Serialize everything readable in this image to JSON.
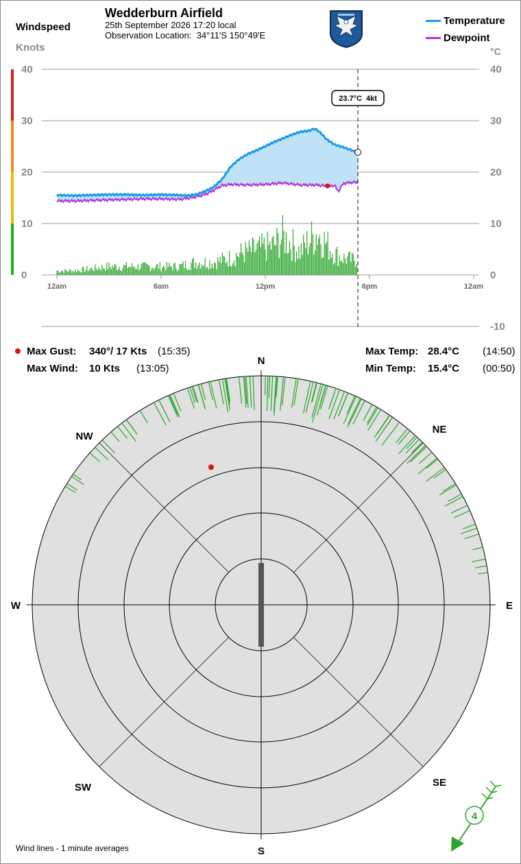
{
  "station": {
    "name": "Wedderburn Airfield",
    "datetime": "25th September 2026  17:20 local",
    "location_label": "Observation Location:",
    "location_coords": "34°11'S 150°49'E"
  },
  "logo_icon": "club-eagle-shield-icon",
  "left_axis": {
    "title": "Windspeed",
    "unit": "Knots"
  },
  "right_axis": {
    "unit": "°C"
  },
  "legend": [
    {
      "label": "Temperature",
      "color": "#1a9be6"
    },
    {
      "label": "Dewpoint",
      "color": "#b030d8"
    }
  ],
  "cursor_readout": {
    "temp": "23.7°C",
    "wind": "4kt"
  },
  "stats": {
    "max_gust_label": "Max Gust:",
    "max_gust_value": "340°/  17 Kts",
    "max_gust_time": "(15:35)",
    "max_wind_label": "Max Wind:",
    "max_wind_value": "10 Kts",
    "max_wind_time": "(13:05)",
    "max_temp_label": "Max Temp:",
    "max_temp_value": "28.4°C",
    "max_temp_time": "(14:50)",
    "min_temp_label": "Min Temp:",
    "min_temp_value": "15.4°C",
    "min_temp_time": "(00:50)"
  },
  "compass": {
    "labels": [
      "N",
      "NE",
      "E",
      "SE",
      "S",
      "SW",
      "W",
      "NW"
    ],
    "current_wind_knots": "4",
    "gust_direction_deg": 340,
    "gust_knots": 17,
    "current_direction_deg": 0,
    "wind_line_directions_deg": [
      300,
      306,
      312,
      318,
      322,
      326,
      330,
      334,
      336,
      338,
      340,
      342,
      344,
      346,
      348,
      350,
      352,
      354,
      356,
      358,
      0,
      2,
      4,
      6,
      8,
      10,
      12,
      14,
      16,
      18,
      20,
      22,
      24,
      26,
      28,
      30,
      32,
      34,
      36,
      38,
      40,
      42,
      44,
      46,
      48,
      52,
      56,
      60,
      64,
      68,
      72,
      76,
      80
    ]
  },
  "footer_note": "Wind lines - 1 minute averages",
  "colors": {
    "temperature": "#1a9be6",
    "dewpoint": "#b030d8",
    "temp_fill": "#bfe2f7",
    "wind_bars": "#2ca52c",
    "gust_marker": "#e01010",
    "scale_green": "#22aa22",
    "scale_yellow": "#e8c000",
    "scale_orange": "#f08a20",
    "scale_red": "#d42020",
    "compass_fill": "#e0e0e0"
  },
  "chart_data": {
    "type": "line",
    "x_axis": {
      "ticks": [
        "12am",
        "6am",
        "12pm",
        "6pm",
        "12am"
      ],
      "range_hours": [
        0,
        24
      ],
      "current_time_hours": 17.33
    },
    "left_axis": {
      "ticks": [
        "0",
        "10",
        "20",
        "30",
        "40"
      ],
      "range": [
        0,
        40
      ],
      "label": "Knots"
    },
    "right_axis": {
      "ticks": [
        "-10",
        "0",
        "10",
        "20",
        "30",
        "40"
      ],
      "range": [
        -10,
        40
      ],
      "label": "°C"
    },
    "grid": true,
    "legend_position": "top-right",
    "series": [
      {
        "name": "Temperature",
        "x": [
          0,
          1,
          2,
          3,
          4,
          5,
          6,
          7,
          7.5,
          8,
          8.5,
          9,
          9.5,
          10,
          10.5,
          11,
          11.5,
          12,
          12.5,
          13,
          13.5,
          14,
          14.5,
          14.83,
          15,
          15.25,
          15.5,
          16,
          16.5,
          17,
          17.33
        ],
        "y": [
          15.5,
          15.4,
          15.5,
          15.6,
          15.6,
          15.5,
          15.6,
          15.5,
          15.4,
          15.6,
          16.2,
          17.0,
          18.5,
          21.0,
          22.5,
          23.5,
          24.2,
          25.0,
          25.8,
          26.5,
          27.2,
          27.8,
          28.0,
          28.4,
          28.1,
          27.4,
          26.4,
          25.3,
          24.8,
          24.2,
          23.7
        ]
      },
      {
        "name": "Dewpoint",
        "x": [
          0,
          1,
          2,
          3,
          4,
          5,
          6,
          7,
          7.5,
          8,
          8.5,
          9,
          9.5,
          10,
          11,
          12,
          13,
          14,
          15,
          15.5,
          16,
          16.2,
          16.5,
          17,
          17.33
        ],
        "y": [
          14.4,
          14.4,
          14.5,
          14.6,
          14.7,
          14.8,
          14.8,
          14.7,
          14.9,
          15.2,
          15.6,
          16.4,
          17.4,
          17.6,
          17.5,
          17.6,
          17.9,
          17.5,
          17.5,
          17.3,
          17.4,
          16.2,
          17.8,
          18.0,
          18.0
        ]
      },
      {
        "name": "Windspeed",
        "x": [
          0,
          1,
          2,
          3,
          4,
          5,
          6,
          7,
          8,
          9,
          9.5,
          10,
          10.5,
          11,
          11.5,
          12,
          12.5,
          13,
          13.5,
          14,
          14.5,
          15,
          15.5,
          16,
          16.5,
          17,
          17.33
        ],
        "y": [
          1,
          1,
          1.5,
          2,
          2,
          2,
          2,
          2,
          3,
          3,
          3.5,
          4,
          5,
          5.5,
          6,
          6.5,
          7,
          9,
          7.5,
          5.5,
          8,
          10,
          7.5,
          5,
          4,
          3.5,
          4
        ]
      }
    ],
    "gust_marker": {
      "x": 15.58,
      "knots": 17
    }
  }
}
